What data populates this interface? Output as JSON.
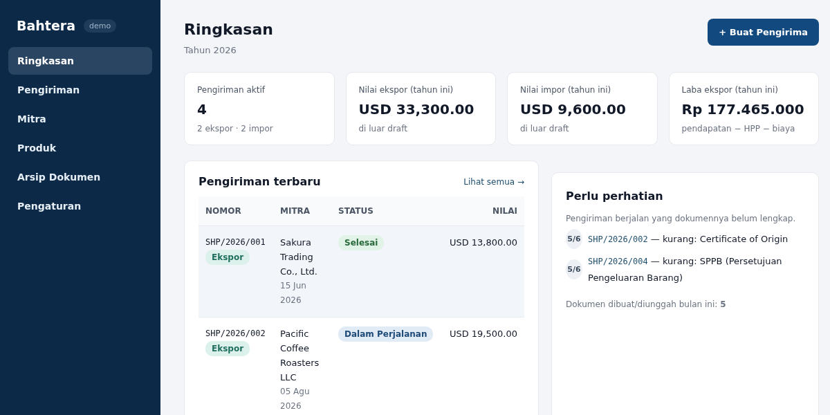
{
  "sidebar": {
    "brand": "Bahtera",
    "badge": "demo",
    "items": [
      {
        "label": "Ringkasan",
        "selected": true
      },
      {
        "label": "Pengiriman",
        "selected": false
      },
      {
        "label": "Mitra",
        "selected": false
      },
      {
        "label": "Produk",
        "selected": false
      },
      {
        "label": "Arsip Dokumen",
        "selected": false
      },
      {
        "label": "Pengaturan",
        "selected": false
      }
    ]
  },
  "header": {
    "title": "Ringkasan",
    "subtitle": "Tahun 2026",
    "button": "+ Buat Pengirima"
  },
  "stats": [
    {
      "label": "Pengiriman aktif",
      "value": "4",
      "note": "2 ekspor · 2 impor"
    },
    {
      "label": "Nilai ekspor (tahun ini)",
      "value": "USD 33,300.00",
      "note": "di luar draft"
    },
    {
      "label": "Nilai impor (tahun ini)",
      "value": "USD 9,600.00",
      "note": "di luar draft"
    },
    {
      "label": "Laba ekspor (tahun ini)",
      "value": "Rp 177.465.000",
      "note": "pendapatan − HPP − biaya"
    }
  ],
  "recent": {
    "title": "Pengiriman terbaru",
    "link": "Lihat semua →",
    "columns": [
      "NOMOR",
      "MITRA",
      "STATUS",
      "NILAI"
    ],
    "rows": [
      {
        "number": "SHP/2026/001",
        "type": "Ekspor",
        "partner": "Sakura Trading Co., Ltd.",
        "date": "15 Jun 2026",
        "status": {
          "label": "Selesai",
          "kind": "done"
        },
        "value": "USD 13,800.00",
        "selected": true
      },
      {
        "number": "SHP/2026/002",
        "type": "Ekspor",
        "partner": "Pacific Coffee Roasters LLC",
        "date": "05 Agu 2026",
        "status": {
          "label": "Dalam Perjalanan",
          "kind": "transit"
        },
        "value": "USD 19,500.00",
        "selected": false
      }
    ]
  },
  "attention": {
    "title": "Perlu perhatian",
    "intro": "Pengiriman berjalan yang dokumennya belum lengkap.",
    "items": [
      {
        "progress": "5/6",
        "number": "SHP/2026/002",
        "text": "— kurang: Certificate of Origin"
      },
      {
        "progress": "5/6",
        "number": "SHP/2026/004",
        "text": "— kurang: SPPB (Persetujuan Pengeluaran Barang)"
      }
    ],
    "footer": "Dokumen dibuat/diunggah bulan ini: **5**"
  }
}
